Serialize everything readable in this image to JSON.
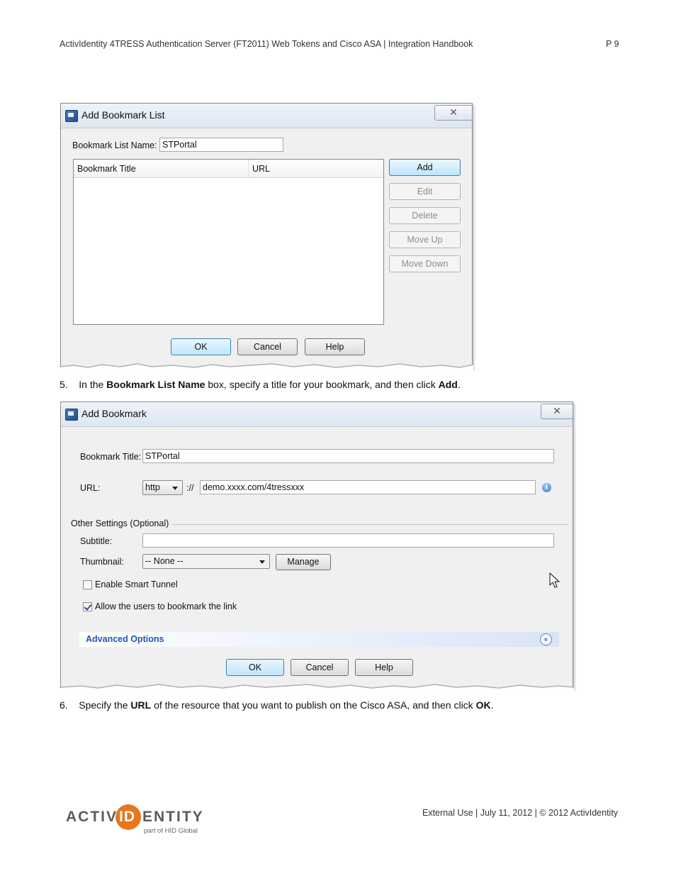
{
  "header": {
    "title": "ActivIdentity 4TRESS Authentication Server (FT2011) Web Tokens and Cisco ASA | Integration Handbook",
    "page": "P 9"
  },
  "dialog1": {
    "title": "Add Bookmark List",
    "close_symbol": "✕",
    "name_label": "Bookmark List Name:",
    "name_value": "STPortal",
    "columns": [
      "Bookmark Title",
      "URL"
    ],
    "buttons": {
      "add": "Add",
      "edit": "Edit",
      "delete": "Delete",
      "move_up": "Move Up",
      "move_down": "Move Down"
    },
    "footer_buttons": {
      "ok": "OK",
      "cancel": "Cancel",
      "help": "Help"
    }
  },
  "step5": {
    "number": "5.",
    "pre": "In the ",
    "bold1": "Bookmark List Name",
    "mid": " box, specify a title for your bookmark, and then click ",
    "bold2": "Add",
    "post": "."
  },
  "dialog2": {
    "title": "Add Bookmark",
    "close_symbol": "✕",
    "bookmark_title_label": "Bookmark Title:",
    "bookmark_title_value": "STPortal",
    "url_label": "URL:",
    "protocol": "http",
    "separator": "://",
    "url_value": "demo.xxxx.com/4tressxxx",
    "info_glyph": "i",
    "other_settings": "Other Settings (Optional)",
    "subtitle_label": "Subtitle:",
    "subtitle_value": "",
    "thumbnail_label": "Thumbnail:",
    "thumbnail_value": "-- None --",
    "manage": "Manage",
    "enable_smart_tunnel": "Enable Smart Tunnel",
    "enable_smart_tunnel_checked": false,
    "allow_bookmark": "Allow the users to bookmark the link",
    "allow_bookmark_checked": true,
    "advanced_options": "Advanced Options",
    "advanced_chevron": "»",
    "footer_buttons": {
      "ok": "OK",
      "cancel": "Cancel",
      "help": "Help"
    }
  },
  "step6": {
    "number": "6.",
    "pre": "Specify the ",
    "bold1": "URL",
    "mid": " of the resource that you want to publish on the Cisco ASA, and then click ",
    "bold2": "OK",
    "post": "."
  },
  "footer": {
    "logo_left": "ACTIV",
    "logo_mid": "ID",
    "logo_right": "ENTITY",
    "logo_tagline": "part of HID Global",
    "text": "External Use | July 11, 2012 | © 2012 ActivIdentity"
  },
  "colors": {
    "logo_orange": "#e8761e",
    "logo_gray": "#5a5c60",
    "accent_blue": "#1f56b2"
  }
}
